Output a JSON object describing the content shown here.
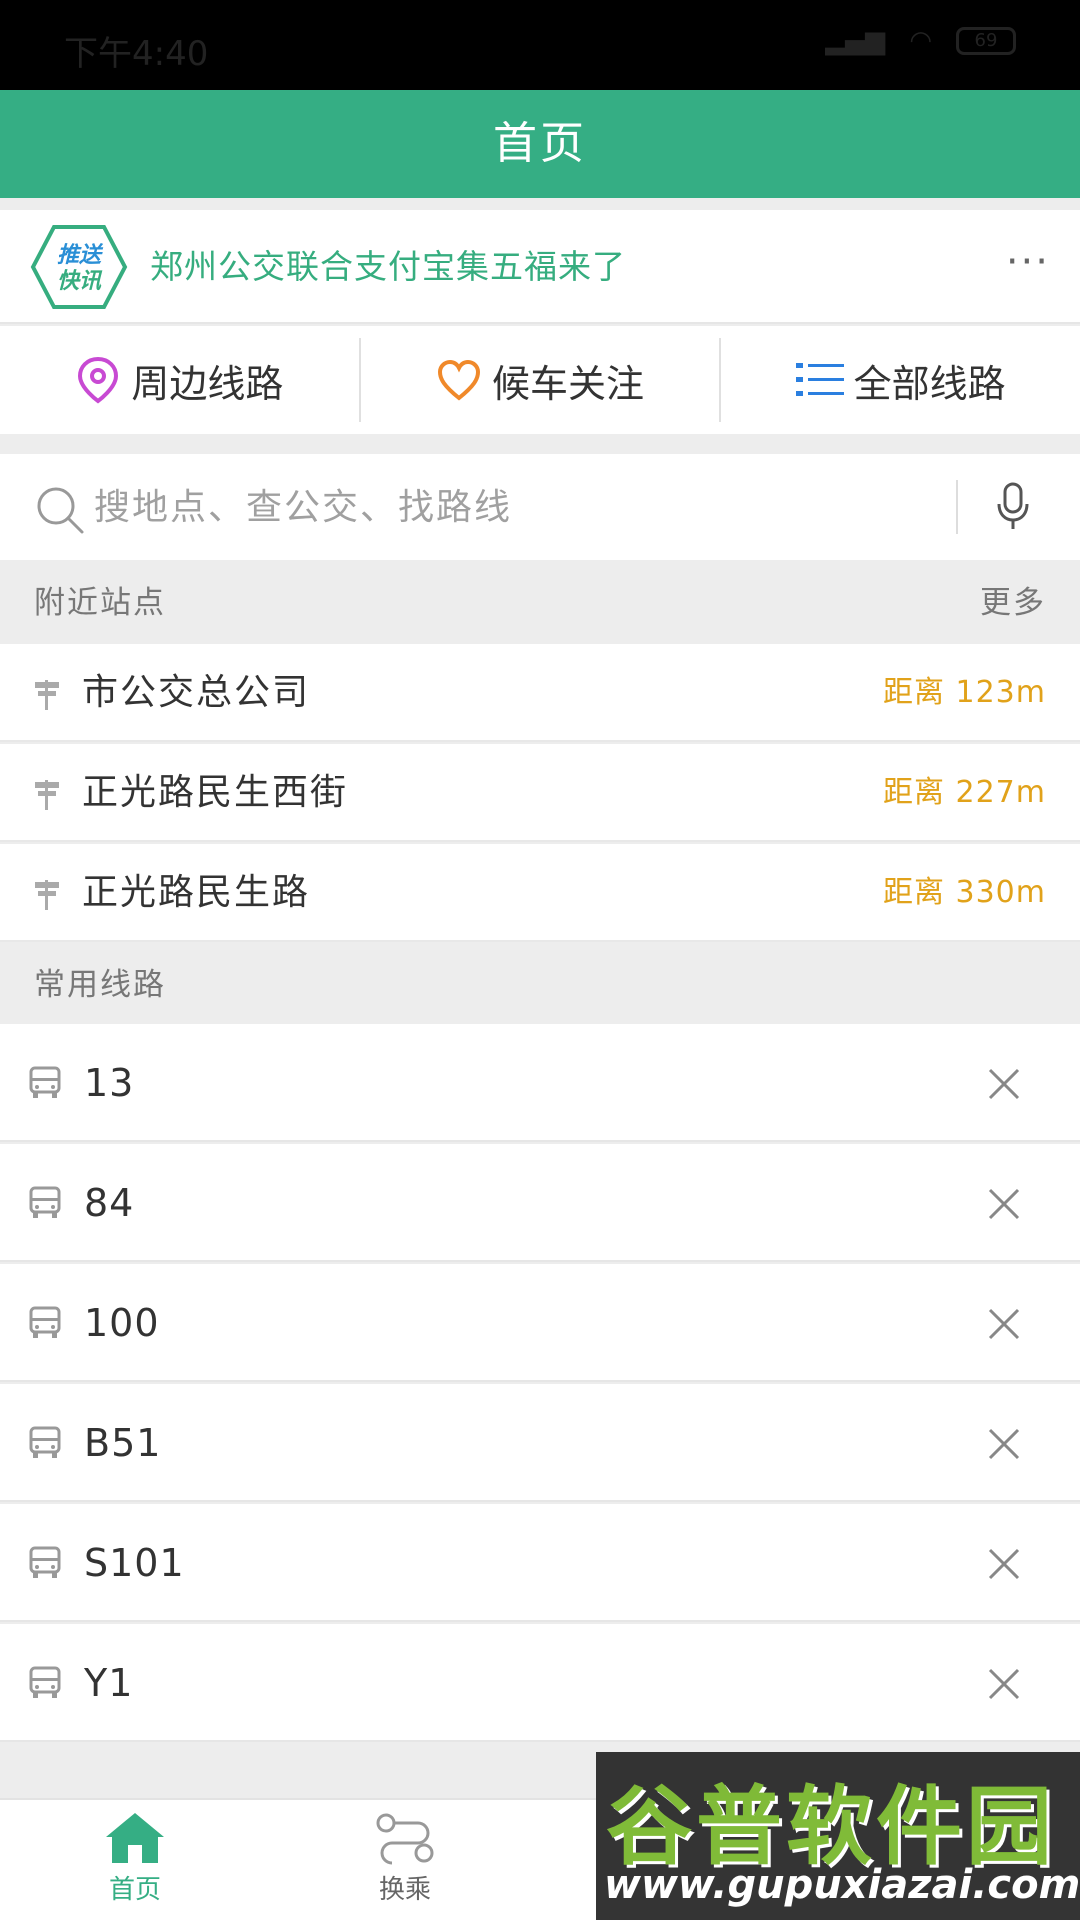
{
  "status_bar": {
    "time": "下午4:40",
    "battery": "69"
  },
  "header": {
    "title": "首页"
  },
  "news": {
    "badge": "推送快讯",
    "text": "郑州公交联合支付宝集五福来了",
    "more": "···"
  },
  "quick_links": [
    {
      "label": "周边线路",
      "icon": "location-pin-icon",
      "color": "#c84ad3"
    },
    {
      "label": "候车关注",
      "icon": "heart-icon",
      "color": "#f0892a"
    },
    {
      "label": "全部线路",
      "icon": "list-icon",
      "color": "#2a7fe0"
    }
  ],
  "search": {
    "placeholder": "搜地点、查公交、找路线"
  },
  "nearby": {
    "title": "附近站点",
    "more": "更多",
    "stations": [
      {
        "name": "市公交总公司",
        "distance": "距离 123m"
      },
      {
        "name": "正光路民生西街",
        "distance": "距离 227m"
      },
      {
        "name": "正光路民生路",
        "distance": "距离 330m"
      }
    ]
  },
  "common_routes": {
    "title": "常用线路",
    "routes": [
      "13",
      "84",
      "100",
      "B51",
      "S101",
      "Y1"
    ]
  },
  "tabs": [
    {
      "label": "首页",
      "active": true
    },
    {
      "label": "换乘",
      "active": false
    }
  ],
  "watermark": {
    "title": "谷普软件园",
    "url": "www.gupuxiazai.com"
  },
  "colors": {
    "brand": "#35ae84",
    "distance": "#e1a21a",
    "news": "#36ad7f"
  }
}
